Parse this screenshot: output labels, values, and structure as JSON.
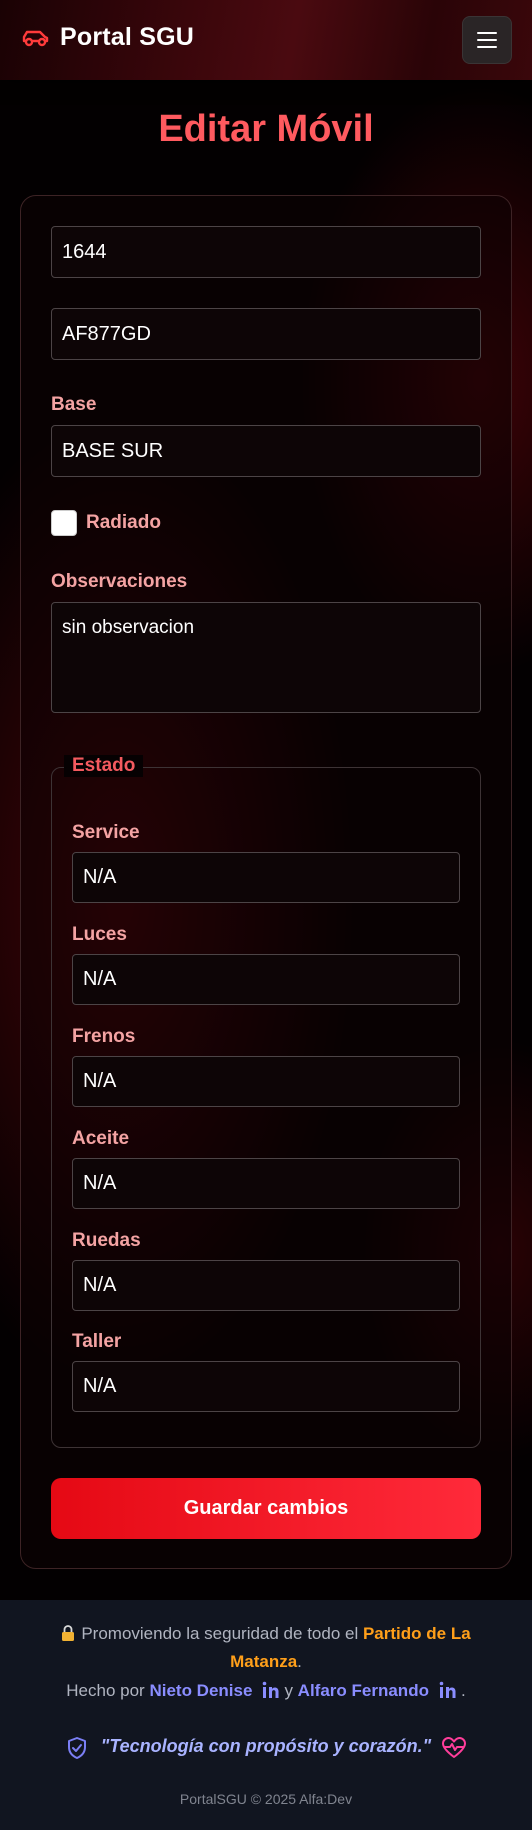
{
  "navbar": {
    "brand": "Portal SGU",
    "brand_icon": "car-icon",
    "menu_icon": "hamburger-icon"
  },
  "page": {
    "title": "Editar Móvil"
  },
  "form": {
    "numero_value": "1644",
    "patente_value": "AF877GD",
    "base_label": "Base",
    "base_value": "BASE SUR",
    "radiado_label": "Radiado",
    "radiado_checked": false,
    "observaciones_label": "Observaciones",
    "observaciones_value": "sin observacion",
    "estado_legend": "Estado",
    "estado": [
      {
        "label": "Service",
        "value": "N/A"
      },
      {
        "label": "Luces",
        "value": "N/A"
      },
      {
        "label": "Frenos",
        "value": "N/A"
      },
      {
        "label": "Aceite",
        "value": "N/A"
      },
      {
        "label": "Ruedas",
        "value": "N/A"
      },
      {
        "label": "Taller",
        "value": "N/A"
      }
    ],
    "save_label": "Guardar cambios"
  },
  "footer": {
    "line1_prefix": "Promoviendo la seguridad de todo el",
    "line1_highlight_a": "Partido de La",
    "line1_highlight_b": "Matanza",
    "line1_suffix": ".",
    "line2_prefix": "Hecho por",
    "author1": "Nieto Denise",
    "connector": "y",
    "author2": "Alfaro Fernando",
    "line2_suffix": ".",
    "quote": "\"Tecnología con propósito y corazón.\"",
    "copyright": "PortalSGU © 2025 Alfa:Dev"
  },
  "colors": {
    "accent": "#ff5a5f",
    "button": "#e50914",
    "label": "#f4a3a3",
    "footer_bg": "#111520",
    "orange": "#ff9f1a",
    "blue": "#8a8dff"
  }
}
